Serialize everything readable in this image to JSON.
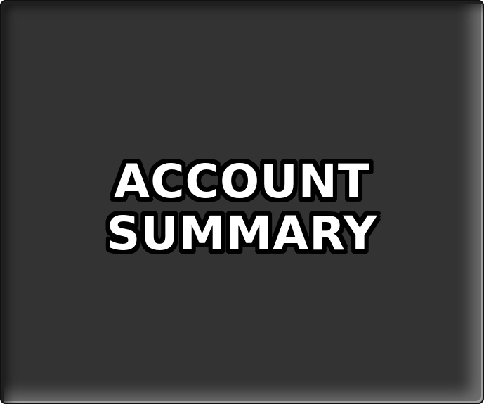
{
  "tile": {
    "line1": "ACCOUNT",
    "line2": "SUMMARY",
    "background_color": "#333333",
    "text_color": "#ffffff",
    "outline_color": "#000000"
  }
}
